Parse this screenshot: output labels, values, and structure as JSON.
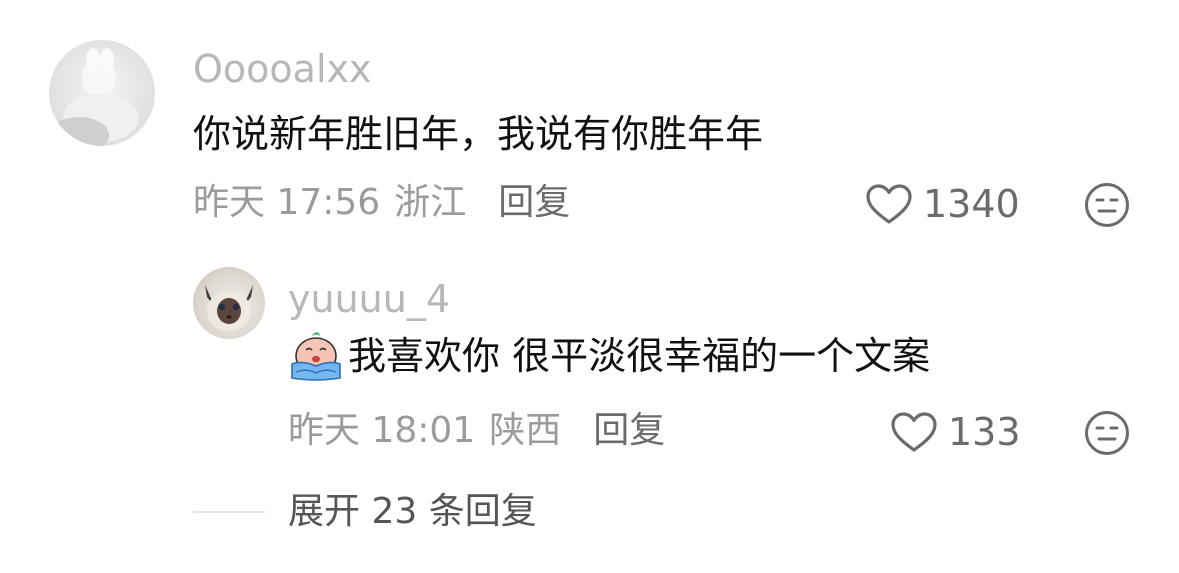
{
  "comments": [
    {
      "username": "Ooooalxx",
      "text": "你说新年胜旧年，我说有你胜年年",
      "time": "昨天 17:56",
      "location": "浙江",
      "reply_label": "回复",
      "likes": "1340"
    }
  ],
  "reply": {
    "username": "yuuuu_4",
    "text": "我喜欢你 很平淡很幸福的一个文案",
    "time": "昨天 18:01",
    "location": "陕西",
    "reply_label": "回复",
    "likes": "133"
  },
  "expand_label": "展开 23 条回复",
  "icons": {
    "like": "heart-outline-icon",
    "react": "meh-face-icon",
    "emoji": "crying-emoji-icon"
  },
  "colors": {
    "username": "#b7b7b7",
    "text": "#111111",
    "meta": "#9b9b9b",
    "secondary": "#6b6b6b"
  }
}
